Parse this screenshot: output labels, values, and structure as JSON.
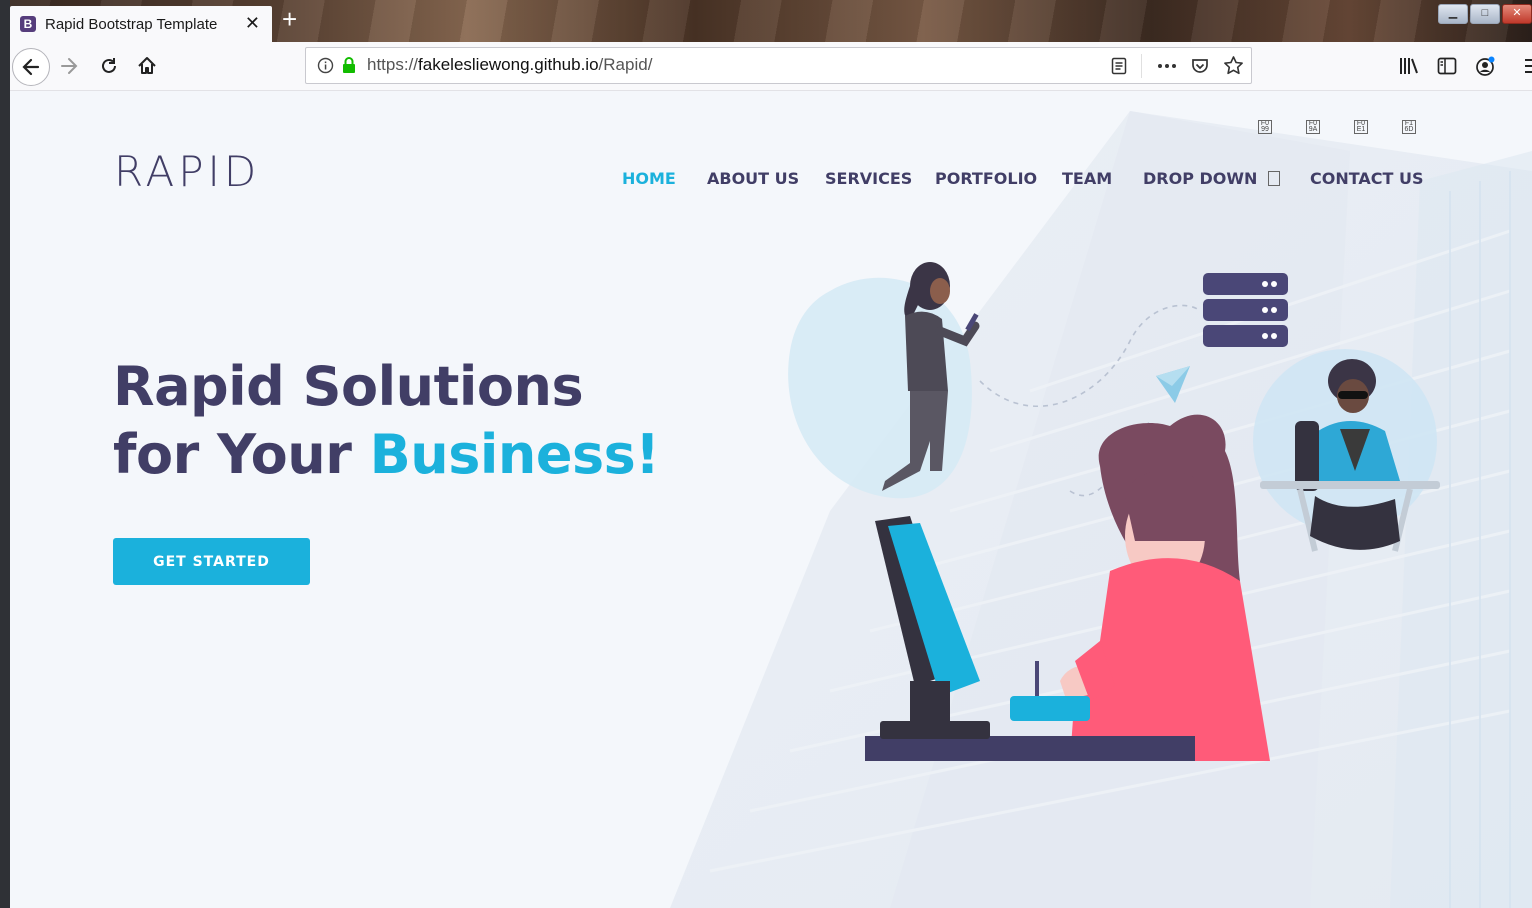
{
  "browser": {
    "tab_title": "Rapid Bootstrap Template",
    "tab_favicon": "B",
    "tab_close": "✕",
    "new_tab": "+",
    "url_scheme": "https://",
    "url_host": "fakelesliewong.github.io",
    "url_path": "/Rapid/",
    "icons": [
      "back-icon",
      "forward-icon",
      "reload-icon",
      "home-icon",
      "info-icon",
      "lock-icon",
      "reader-view-icon",
      "more-icon",
      "pocket-icon",
      "bookmark-star-icon",
      "library-icon",
      "sidebar-icon",
      "account-icon",
      "menu-icon"
    ]
  },
  "site": {
    "logo": "RAPID",
    "nav": [
      {
        "label": "HOME",
        "active": true
      },
      {
        "label": "ABOUT US",
        "active": false
      },
      {
        "label": "SERVICES",
        "active": false
      },
      {
        "label": "PORTFOLIO",
        "active": false
      },
      {
        "label": "TEAM",
        "active": false
      },
      {
        "label": "DROP DOWN",
        "active": false
      },
      {
        "label": "CONTACT US",
        "active": false
      }
    ],
    "hero": {
      "line1": "Rapid Solutions",
      "line2_prefix": "for Your ",
      "line2_accent": "Business!",
      "cta": "GET STARTED"
    }
  },
  "colors": {
    "primary": "#413e66",
    "accent": "#1bb1dc",
    "page_bg": "#f4f7fb"
  }
}
